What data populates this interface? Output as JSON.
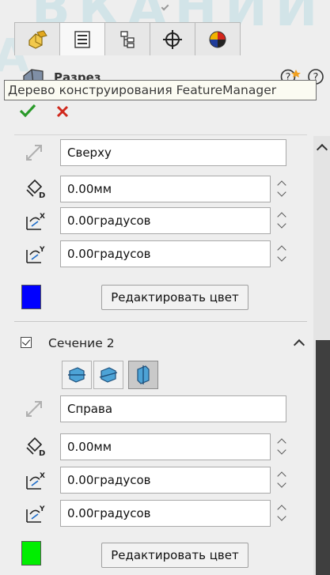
{
  "panel": {
    "title": "Разрез",
    "tooltip": "Дерево конструирования FeatureManager"
  },
  "section1": {
    "reference": "Сверху",
    "offset": "0.00мм",
    "rotation_x": "0.00градусов",
    "rotation_y": "0.00градусов",
    "color": "#0000ff",
    "edit_color_label": "Редактировать цвет"
  },
  "section2": {
    "label": "Сечение 2",
    "checked": true,
    "reference": "Справа",
    "offset": "0.00мм",
    "rotation_x": "0.00градусов",
    "rotation_y": "0.00градусов",
    "color": "#00ee00",
    "edit_color_label": "Редактировать цвет"
  },
  "icons": {
    "tabs": [
      "feature-manager-icon",
      "property-manager-icon",
      "configuration-manager-icon",
      "dimxpert-icon",
      "display-manager-icon"
    ],
    "help": [
      "help-icon",
      "help-icon"
    ],
    "ok": "checkmark-icon",
    "cancel": "close-icon"
  },
  "colors": {
    "accept": "#2a9a2a",
    "cancel": "#d0281c",
    "scroll_thumb": "#3f3f3f"
  }
}
